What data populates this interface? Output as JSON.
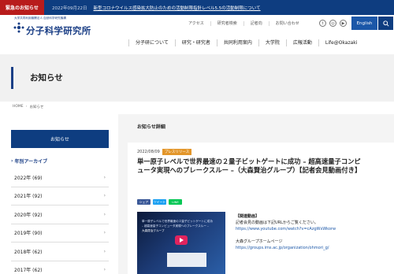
{
  "alert": {
    "label": "緊急のお知らせ",
    "date": "2022年09月22日",
    "text": "新型コロナウイルス感染拡大防止のための活動制限指針レベル5.5の活動制限について"
  },
  "header": {
    "logo_sub": "大学共同利用機関法人 自然科学研究機構",
    "logo_main": "分子科学研究所",
    "util_links": [
      "アクセス",
      "研究者検索",
      "記者向",
      "お問い合わせ"
    ],
    "social_icons": [
      "twitter-icon",
      "instagram-icon",
      "youtube-icon"
    ],
    "english_label": "English",
    "nav": [
      "分子研について",
      "研究・研究者",
      "共同利用案内",
      "大学院",
      "広報活動",
      "Life@Okazaki"
    ]
  },
  "page": {
    "title": "お知らせ",
    "breadcrumb": [
      "HOME",
      "お知らせ"
    ]
  },
  "sidebar": {
    "heading": "お知らせ",
    "category": "年別アーカイブ",
    "items": [
      {
        "label": "2022年 (69)"
      },
      {
        "label": "2021年 (92)"
      },
      {
        "label": "2020年 (92)"
      },
      {
        "label": "2019年 (90)"
      },
      {
        "label": "2018年 (62)"
      },
      {
        "label": "2017年 (62)"
      }
    ]
  },
  "main": {
    "detail_heading": "お知らせ詳細",
    "date": "2022/08/09",
    "badge": "プレスリリース",
    "title": "単一原子レベルで世界最速の２量子ビットゲートに成功 – 超高速量子コンピュータ実現へのブレークスルー –（大森賢治グループ）【記者会見動画付き】",
    "share": [
      "シェア",
      "ツイート",
      "LINE"
    ],
    "video": {
      "caption1": "単一原子レベルで世界最速の２量子ビットゲートに成功",
      "caption2": "– 超高速量子コンピュータ実現へのブレークスルー –",
      "caption3": "大森賢治グループ"
    },
    "links": {
      "heading": "【関連動画】",
      "text1": "記者会見の動画は下記URLからご覧ください。",
      "url1": "https://www.youtube.com/watch?v=cAzgWsWkorw",
      "text2": "大森グループホームページ",
      "url2": "https://groups.ims.ac.jp/organization/ohmori_g/"
    }
  }
}
